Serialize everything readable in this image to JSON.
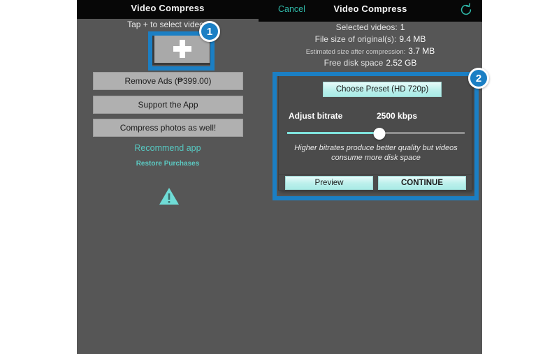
{
  "app": {
    "left_header": {
      "title": "Video Compress"
    },
    "modal_header": {
      "cancel_label": "Cancel",
      "title": "Video Compress",
      "refresh_icon": "refresh-icon"
    }
  },
  "left_panel": {
    "tap_hint": "Tap + to select videos",
    "add_tile_icon": "plus-icon",
    "buttons": [
      {
        "label": "Remove Ads (₱399.00)"
      },
      {
        "label": "Support the App"
      },
      {
        "label": "Compress photos as well!"
      }
    ],
    "links": [
      {
        "label": "Recommend app"
      },
      {
        "label": "Restore Purchases"
      }
    ],
    "warning_icon": "warning-triangle-icon"
  },
  "info": {
    "rows": [
      {
        "label": "Selected videos:",
        "value": "1",
        "small": false
      },
      {
        "label": "File size of original(s):",
        "value": "9.4 MB",
        "small": false
      },
      {
        "label": "Estimated size after compression:",
        "value": "3.7 MB",
        "small": true
      },
      {
        "label": "Free disk space",
        "value": "2.52 GB",
        "small": false
      }
    ]
  },
  "settings_panel": {
    "preset_button": "Choose Preset (HD 720p)",
    "bitrate_label": "Adjust bitrate",
    "bitrate_value": "2500 kbps",
    "slider_percent": 52,
    "hint": "Higher bitrates produce better quality but videos consume more disk space",
    "preview_button": "Preview",
    "continue_button": "CONTINUE"
  },
  "annotations": {
    "step1": "1",
    "step2": "2",
    "accent_color": "#1b7fc4"
  }
}
